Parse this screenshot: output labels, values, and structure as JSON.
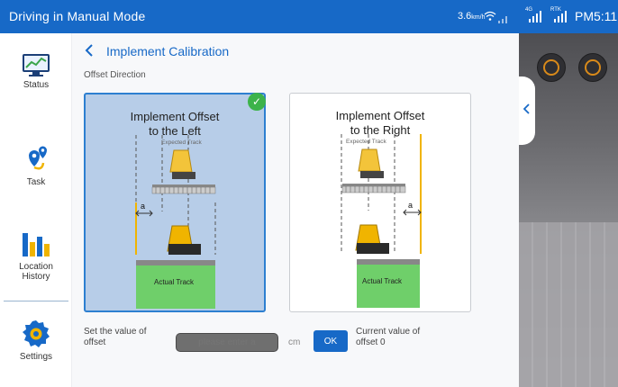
{
  "topbar": {
    "title": "Driving in Manual Mode",
    "speed_value": "3.6",
    "speed_unit": "km/h",
    "signal_4g_label": "4G",
    "signal_rtk_label": "RTK",
    "time": "PM5:11",
    "background_color": "#1769c7"
  },
  "sidebar": {
    "items": [
      {
        "label": "Status",
        "icon": "chart-line-icon"
      },
      {
        "label": "Task",
        "icon": "route-pin-icon"
      },
      {
        "label": "Location History",
        "icon": "bar-chart-icon"
      },
      {
        "label": "Settings",
        "icon": "gear-icon"
      }
    ]
  },
  "main": {
    "back_icon": "chevron-left-icon",
    "heading": "Implement Calibration",
    "subheading": "Offset Direction",
    "cards": [
      {
        "title_line1": "Implement Offset",
        "title_line2": "to the Left",
        "expected_track": "Expected Track",
        "actual_track": "Actual Track",
        "offset_label": "a",
        "selected": true
      },
      {
        "title_line1": "Implement Offset",
        "title_line2": "to the Right",
        "expected_track": "Expected Track",
        "actual_track": "Actual Track",
        "offset_label": "a",
        "selected": false
      }
    ],
    "selected_check": "✓",
    "offset_label_line1": "Set the value of",
    "offset_label_line2": "offset",
    "offset_input_placeholder": "please enter a",
    "unit": "cm",
    "ok_label": "OK",
    "current_label_line1": "Current value of",
    "current_label_line2": "offset 0"
  },
  "viewport": {
    "collapse_icon": "chevron-left-icon",
    "buttons": [
      "camera-icon",
      "target-icon"
    ]
  }
}
